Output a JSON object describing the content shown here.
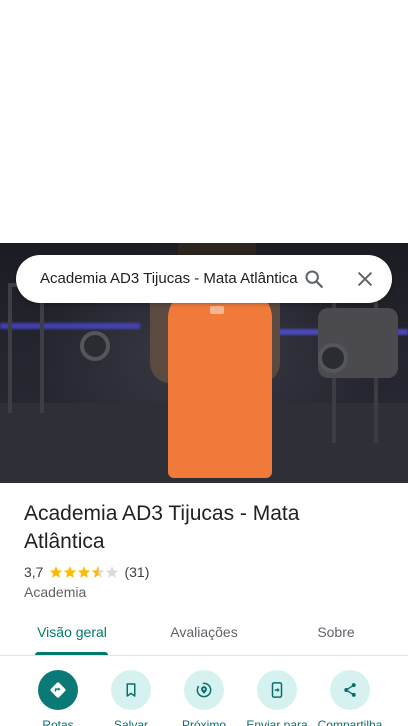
{
  "search": {
    "query": "Academia AD3 Tijucas - Mata Atlântica",
    "search_icon": "search-icon",
    "close_icon": "close-icon"
  },
  "place": {
    "title_line1": "Academia AD3 Tijucas - Mata",
    "title_line2": "Atlântica",
    "rating_value": "3,7",
    "rating_stars": 3.7,
    "review_count": "(31)",
    "category": "Academia"
  },
  "tabs": [
    {
      "label": "Visão geral",
      "selected": true
    },
    {
      "label": "Avaliações",
      "selected": false
    },
    {
      "label": "Sobre",
      "selected": false
    }
  ],
  "actions": [
    {
      "label": "Rotas",
      "icon": "directions-icon"
    },
    {
      "label": "Salvar",
      "icon": "bookmark-icon"
    },
    {
      "label": "Próximo",
      "icon": "nearby-icon"
    },
    {
      "label": "Enviar para",
      "icon": "send-to-phone-icon"
    },
    {
      "label": "Compartilha",
      "icon": "share-icon"
    }
  ],
  "colors": {
    "accent": "#00796b",
    "primary_action": "#0b7a76",
    "action_bg": "#d6f2f0",
    "star": "#fbbc04"
  }
}
